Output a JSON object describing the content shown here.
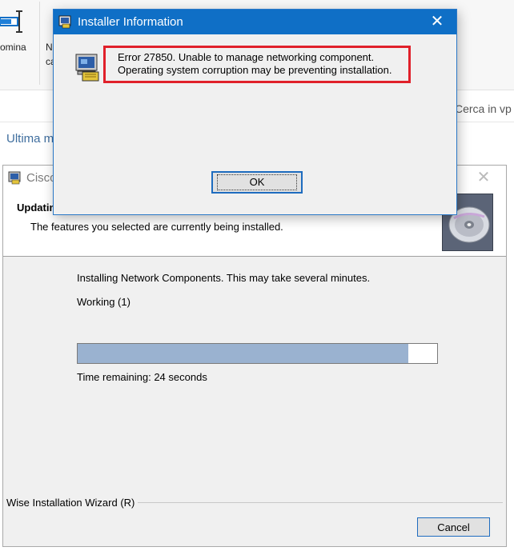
{
  "background": {
    "ribbon": {
      "rename_label": "omina",
      "next_label_line1": "N",
      "next_label_line2": "ca"
    },
    "search_placeholder": "Cerca in vp",
    "recent_label": "Ultima m"
  },
  "setup_window": {
    "title": "Cisco",
    "heading": "Updatin",
    "subheading": "The features you selected are currently being installed.",
    "status": "Installing Network Components. This may take several minutes.",
    "working": "Working  (1)",
    "progress_fraction": 0.92,
    "time_remaining": "Time remaining: 24 seconds",
    "wizard_label": "Wise Installation Wizard (R)",
    "cancel_label": "Cancel",
    "close_glyph": "✕"
  },
  "dialog": {
    "title": "Installer Information",
    "close_glyph": "✕",
    "error_line1": "Error 27850. Unable to manage networking component.",
    "error_line2": "Operating system corruption may be preventing installation.",
    "ok_label": "OK",
    "highlight_color": "#e0202a",
    "titlebar_color": "#0f6fc6"
  }
}
